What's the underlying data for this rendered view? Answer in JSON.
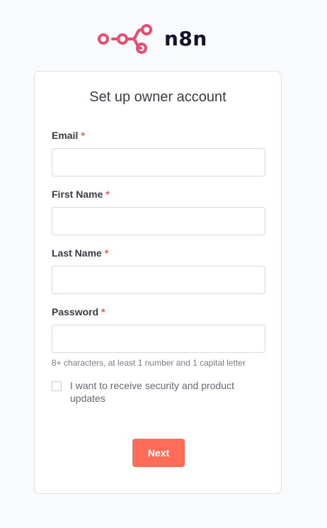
{
  "logo": {
    "text": "n8n",
    "icon": "n8n-nodes-logo-icon",
    "color": "#ea4b71"
  },
  "form": {
    "title": "Set up owner account",
    "required_marker": "*",
    "fields": [
      {
        "label": "Email",
        "value": "",
        "placeholder": ""
      },
      {
        "label": "First Name",
        "value": "",
        "placeholder": ""
      },
      {
        "label": "Last Name",
        "value": "",
        "placeholder": ""
      },
      {
        "label": "Password",
        "value": "",
        "placeholder": ""
      }
    ],
    "password_hint": "8+ characters, at least 1 number and 1 capital letter",
    "checkbox": {
      "label": "I want to receive security and product updates",
      "checked": false
    },
    "submit_label": "Next",
    "submit_color": "#ff6d5a",
    "required_color": "#ef5757"
  }
}
